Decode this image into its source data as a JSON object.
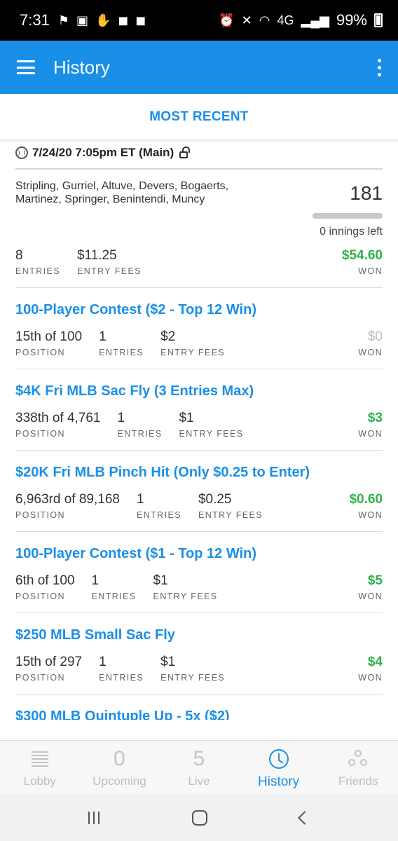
{
  "status_bar": {
    "time": "7:31",
    "network": "4G",
    "battery": "99%"
  },
  "app_bar": {
    "title": "History"
  },
  "section": {
    "title": "MOST RECENT"
  },
  "slate": {
    "title": "7/24/20 7:05pm ET (Main)",
    "players_line1": "Stripling, Gurriel, Altuve, Devers, Bogaerts,",
    "players_line2": "Martinez, Springer, Benintendi, Muncy",
    "score": "181",
    "progress": 0,
    "innings_left": "0 innings left",
    "entries": "8",
    "entries_label": "ENTRIES",
    "entry_fees": "$11.25",
    "entry_fees_label": "ENTRY FEES",
    "won": "$54.60",
    "won_label": "WON"
  },
  "contests": [
    {
      "title": "100-Player Contest ($2 - Top 12 Win)",
      "position": "15th of 100",
      "entries": "1",
      "entry_fees": "$2",
      "won": "$0"
    },
    {
      "title": "$4K Fri MLB Sac Fly (3 Entries Max)",
      "position": "338th of 4,761",
      "entries": "1",
      "entry_fees": "$1",
      "won": "$3"
    },
    {
      "title": "$20K Fri MLB Pinch Hit (Only $0.25 to Enter)",
      "position": "6,963rd of 89,168",
      "entries": "1",
      "entry_fees": "$0.25",
      "won": "$0.60"
    },
    {
      "title": "100-Player Contest ($1 - Top 12 Win)",
      "position": "6th of 100",
      "entries": "1",
      "entry_fees": "$1",
      "won": "$5"
    },
    {
      "title": "$250 MLB Small Sac Fly",
      "position": "15th of 297",
      "entries": "1",
      "entry_fees": "$1",
      "won": "$4"
    }
  ],
  "labels": {
    "position": "POSITION",
    "entries": "ENTRIES",
    "entry_fees": "ENTRY FEES",
    "won": "WON"
  },
  "partial_contest_title": "$300 MLB Quintuple Up - 5x ($2)",
  "bottom_nav": {
    "lobby": "Lobby",
    "upcoming": "Upcoming",
    "upcoming_count": "0",
    "live": "Live",
    "live_count": "5",
    "history": "History",
    "friends": "Friends"
  },
  "colors": {
    "brand_blue": "#1a8fe8",
    "won_green": "#2eb34a"
  }
}
